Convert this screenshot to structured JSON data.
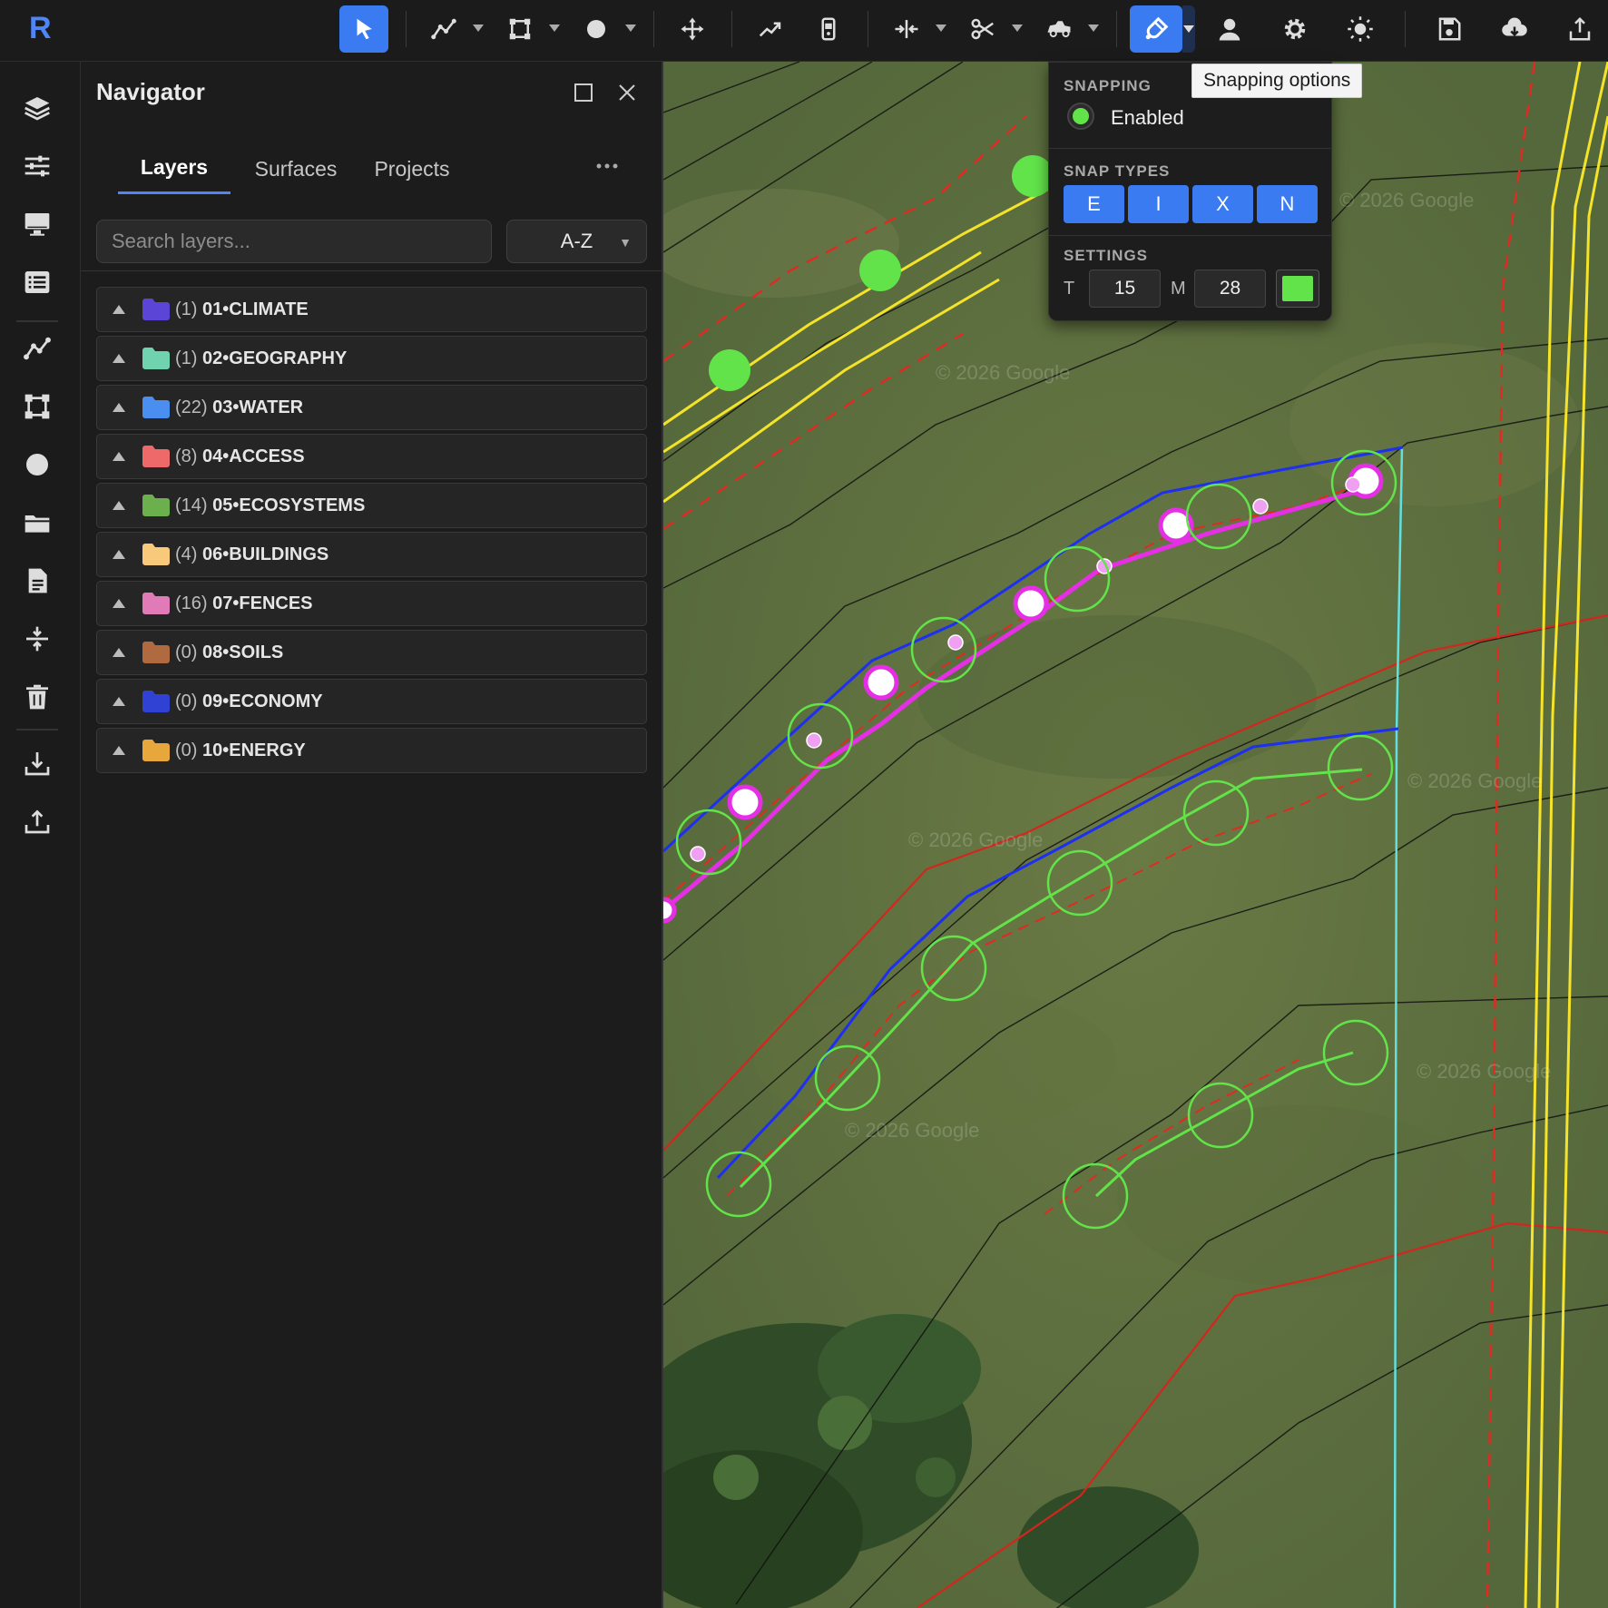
{
  "app": {
    "logo": "R"
  },
  "toolbar": {
    "icons": [
      "select-arrow-icon",
      "draw-line-icon",
      "draw-polygon-icon",
      "draw-point-icon",
      "move-icon",
      "trend-icon",
      "device-icon",
      "split-icon",
      "scissors-icon",
      "vehicle-icon",
      "snap-magnet-icon",
      "user-icon",
      "gear-icon",
      "brightness-icon",
      "save-icon",
      "cloud-download-icon",
      "export-icon"
    ],
    "active": [
      "select",
      "snapping"
    ],
    "accent_color": "#3b7bf2"
  },
  "rail": {
    "icons": [
      "layers-icon",
      "sliders-icon",
      "monitor-icon",
      "list-icon",
      "line-tool-icon",
      "polygon-tool-icon",
      "point-tool-icon",
      "folder-icon",
      "document-icon",
      "compress-icon",
      "trash-icon",
      "import-icon",
      "upload-icon"
    ]
  },
  "navigator": {
    "title": "Navigator",
    "tabs": [
      {
        "label": "Layers",
        "active": true
      },
      {
        "label": "Surfaces",
        "active": false
      },
      {
        "label": "Projects",
        "active": false
      }
    ],
    "search_placeholder": "Search layers...",
    "sort_value": "A-Z",
    "layers": [
      {
        "count": "(1)",
        "name": "01•CLIMATE",
        "color": "#5b45d6"
      },
      {
        "count": "(1)",
        "name": "02•GEOGRAPHY",
        "color": "#6fd3b0"
      },
      {
        "count": "(22)",
        "name": "03•WATER",
        "color": "#4a8ef0"
      },
      {
        "count": "(8)",
        "name": "04•ACCESS",
        "color": "#ee6a6a"
      },
      {
        "count": "(14)",
        "name": "05•ECOSYSTEMS",
        "color": "#6bb04d"
      },
      {
        "count": "(4)",
        "name": "06•BUILDINGS",
        "color": "#f8c97a"
      },
      {
        "count": "(16)",
        "name": "07•FENCES",
        "color": "#e07bb8"
      },
      {
        "count": "(0)",
        "name": "08•SOILS",
        "color": "#b06a40"
      },
      {
        "count": "(0)",
        "name": "09•ECONOMY",
        "color": "#2f42d4"
      },
      {
        "count": "(0)",
        "name": "10•ENERGY",
        "color": "#e8a73a"
      }
    ]
  },
  "snapping": {
    "heading": "SNAPPING",
    "enabled_label": "Enabled",
    "types_heading": "SNAP TYPES",
    "types": [
      "E",
      "I",
      "X",
      "N"
    ],
    "settings_heading": "SETTINGS",
    "t_label": "T",
    "t_value": "15",
    "m_label": "M",
    "m_value": "28",
    "color": "#62e34a"
  },
  "tooltip": "Snapping options",
  "map": {
    "watermark": "© 2026 Google"
  }
}
